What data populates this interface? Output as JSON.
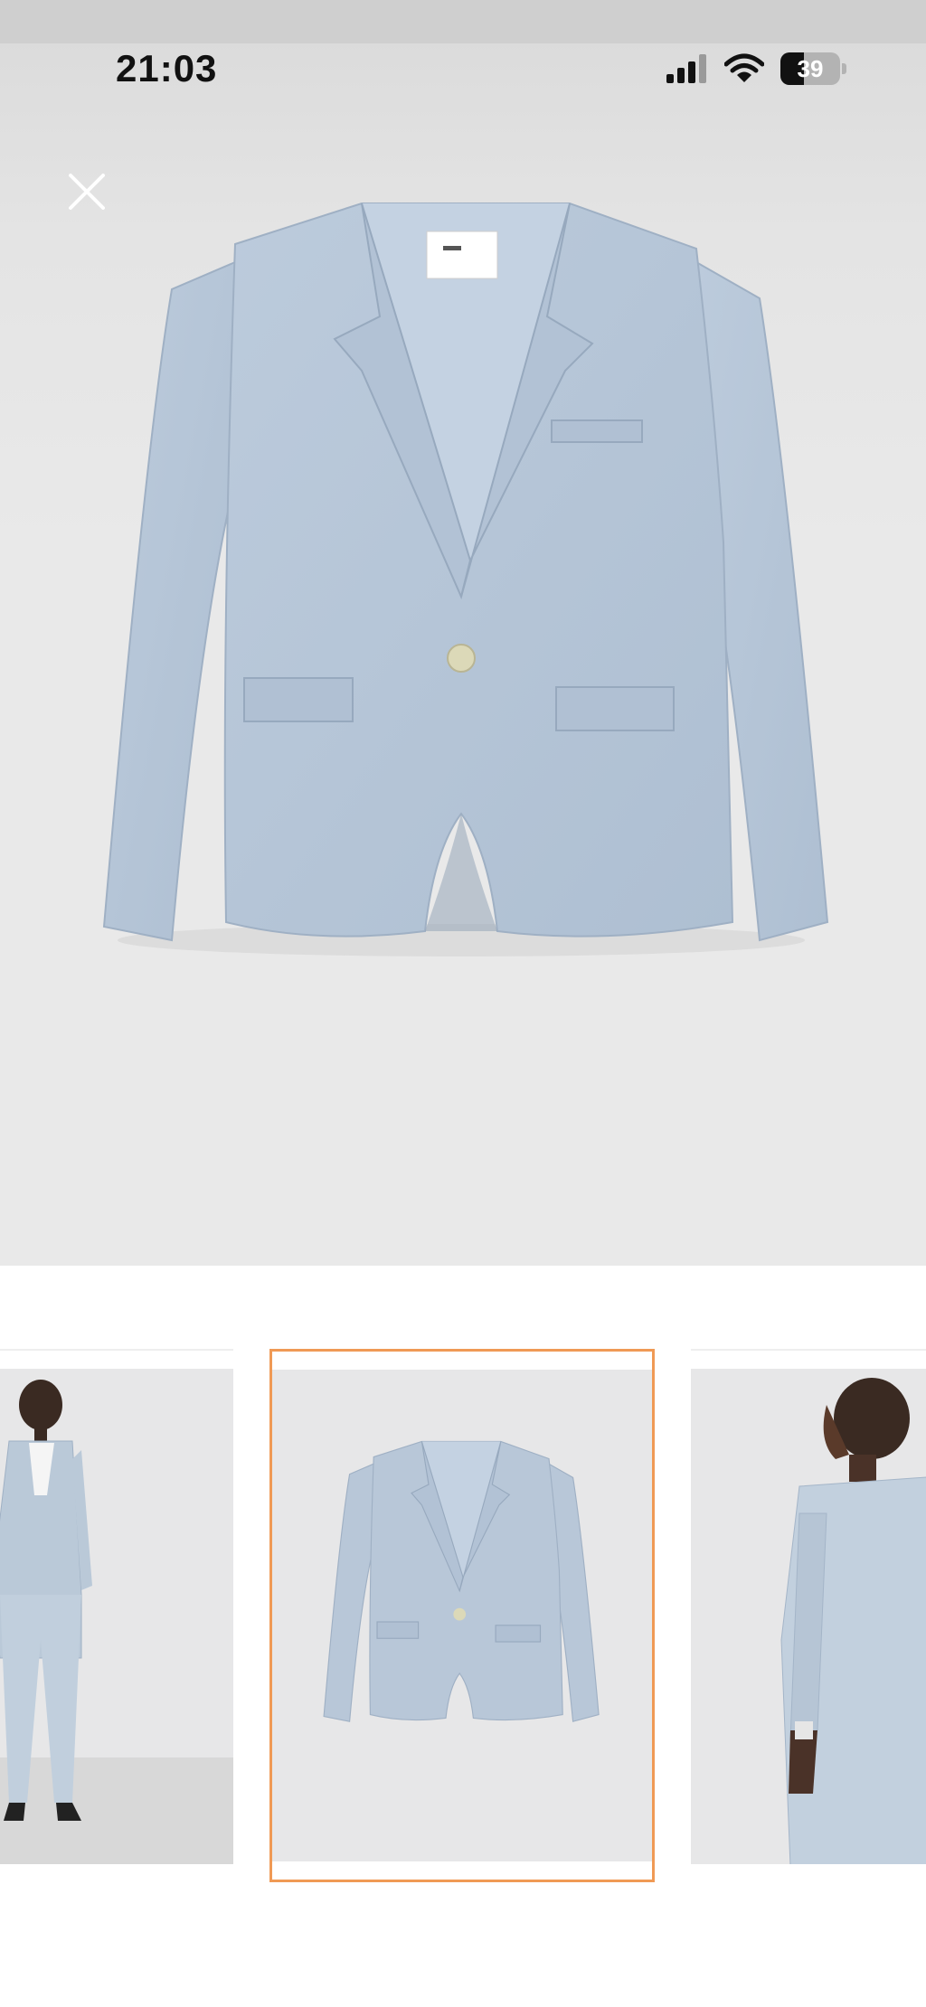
{
  "status_bar": {
    "time": "21:03",
    "battery_level": "39",
    "battery_fraction": 0.39,
    "icons": [
      "signal-icon",
      "wifi-icon",
      "battery-icon"
    ]
  },
  "viewer": {
    "close_icon": "close-icon",
    "image": "blazer-flat-lay-photo",
    "background": "#e9e9e9"
  },
  "thumbnails": [
    {
      "image": "model-front-photo",
      "selected": false
    },
    {
      "image": "blazer-flat-lay-photo",
      "selected": true
    },
    {
      "image": "model-side-photo",
      "selected": false
    }
  ],
  "colors": {
    "selection_border": "#f09a55",
    "blazer": "#b4c4d6",
    "button": "#dcd9b8"
  }
}
